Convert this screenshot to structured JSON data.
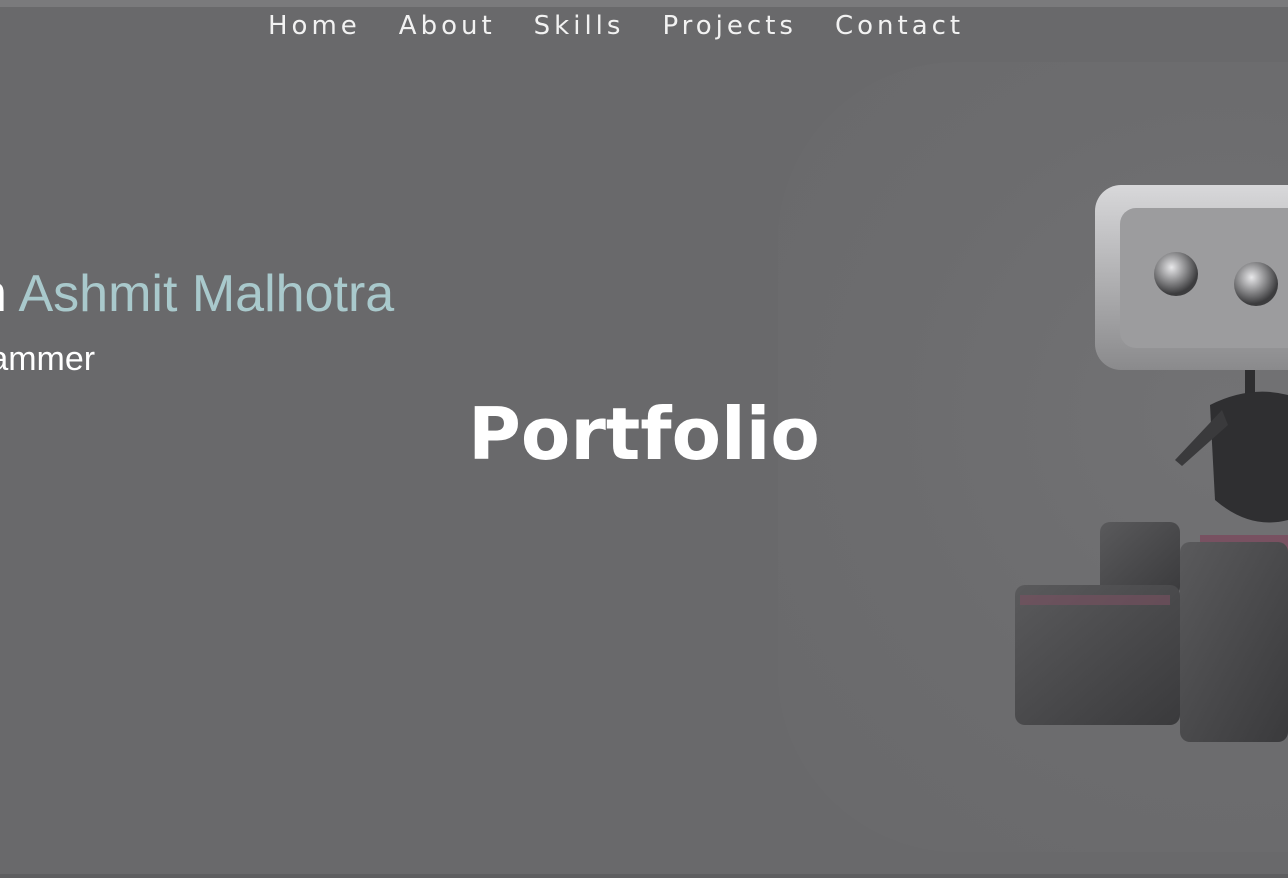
{
  "nav": {
    "items": [
      {
        "label": "Home"
      },
      {
        "label": "About"
      },
      {
        "label": "Skills"
      },
      {
        "label": "Projects"
      },
      {
        "label": "Contact"
      }
    ]
  },
  "hero": {
    "intro_prefix": "n",
    "name": "Ashmit Malhotra",
    "role": "rammer",
    "illustration_icon": "robot-illustration"
  },
  "overlay": {
    "title": "Portfolio"
  },
  "colors": {
    "background": "#69696b",
    "accent_name": "#a9c9cc",
    "text": "#ffffff"
  }
}
